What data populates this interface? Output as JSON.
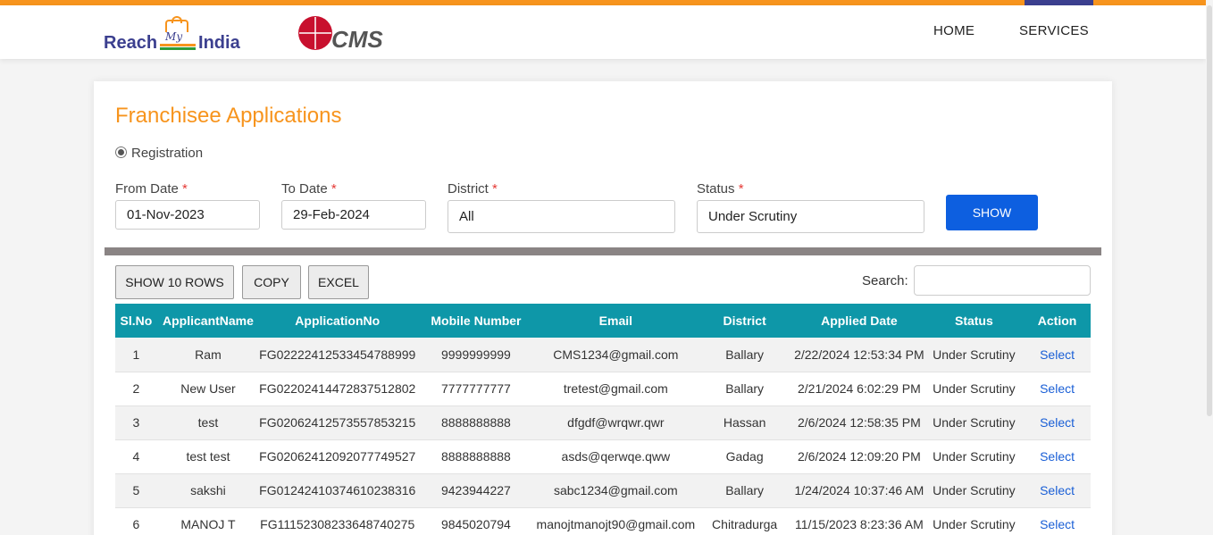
{
  "colors": {
    "accent_orange": "#f7941d",
    "brand_navy": "#3b3f8f",
    "table_header": "#0e97a8",
    "button_blue": "#0d5fe0",
    "link_blue": "#1a5fd6"
  },
  "header": {
    "logo_reach_left": "Reach",
    "logo_reach_my": "My",
    "logo_reach_right": "India",
    "logo_cms": "CMS",
    "nav": [
      "HOME",
      "SERVICES"
    ]
  },
  "page": {
    "title": "Franchisee Applications",
    "radio_label": "Registration"
  },
  "filters": {
    "from_date_label": "From Date",
    "from_date_value": "01-Nov-2023",
    "to_date_label": "To Date",
    "to_date_value": "29-Feb-2024",
    "district_label": "District",
    "district_value": "All",
    "status_label": "Status",
    "status_value": "Under Scrutiny",
    "required_mark": "*",
    "show_button": "SHOW"
  },
  "toolbar": {
    "show_rows": "SHOW 10 ROWS",
    "copy": "COPY",
    "excel": "EXCEL",
    "search_label": "Search:"
  },
  "table": {
    "columns": [
      "Sl.No",
      "ApplicantName",
      "ApplicationNo",
      "Mobile Number",
      "Email",
      "District",
      "Applied Date",
      "Status",
      "Action"
    ],
    "rows": [
      [
        "1",
        "Ram",
        "FG02222412533454788999",
        "9999999999",
        "CMS1234@gmail.com",
        "Ballary",
        "2/22/2024 12:53:34 PM",
        "Under Scrutiny",
        "Select"
      ],
      [
        "2",
        "New User",
        "FG02202414472837512802",
        "7777777777",
        "tretest@gmail.com",
        "Ballary",
        "2/21/2024 6:02:29 PM",
        "Under Scrutiny",
        "Select"
      ],
      [
        "3",
        "test",
        "FG02062412573557853215",
        "8888888888",
        "dfgdf@wrqwr.qwr",
        "Hassan",
        "2/6/2024 12:58:35 PM",
        "Under Scrutiny",
        "Select"
      ],
      [
        "4",
        "test test",
        "FG02062412092077749527",
        "8888888888",
        "asds@qerwqe.qww",
        "Gadag",
        "2/6/2024 12:09:20 PM",
        "Under Scrutiny",
        "Select"
      ],
      [
        "5",
        "sakshi",
        "FG01242410374610238316",
        "9423944227",
        "sabc1234@gmail.com",
        "Ballary",
        "1/24/2024 10:37:46 AM",
        "Under Scrutiny",
        "Select"
      ],
      [
        "6",
        "MANOJ T",
        "FG11152308233648740275",
        "9845020794",
        "manojtmanojt90@gmail.com",
        "Chitradurga",
        "11/15/2023 8:23:36 AM",
        "Under Scrutiny",
        "Select"
      ]
    ]
  }
}
